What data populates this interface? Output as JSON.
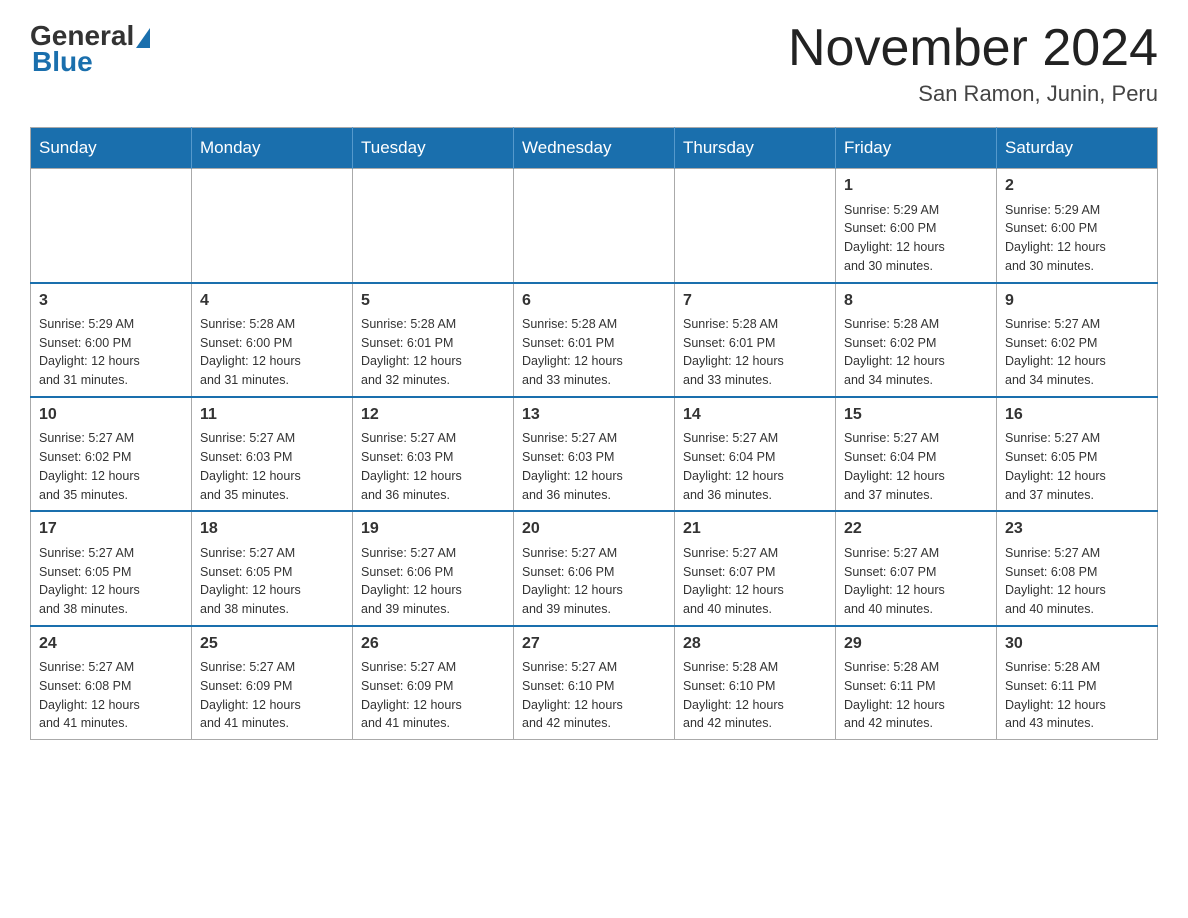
{
  "header": {
    "logo": {
      "general": "General",
      "blue": "Blue"
    },
    "title": "November 2024",
    "location": "San Ramon, Junin, Peru"
  },
  "weekdays": [
    "Sunday",
    "Monday",
    "Tuesday",
    "Wednesday",
    "Thursday",
    "Friday",
    "Saturday"
  ],
  "weeks": [
    [
      {
        "day": "",
        "info": ""
      },
      {
        "day": "",
        "info": ""
      },
      {
        "day": "",
        "info": ""
      },
      {
        "day": "",
        "info": ""
      },
      {
        "day": "",
        "info": ""
      },
      {
        "day": "1",
        "info": "Sunrise: 5:29 AM\nSunset: 6:00 PM\nDaylight: 12 hours\nand 30 minutes."
      },
      {
        "day": "2",
        "info": "Sunrise: 5:29 AM\nSunset: 6:00 PM\nDaylight: 12 hours\nand 30 minutes."
      }
    ],
    [
      {
        "day": "3",
        "info": "Sunrise: 5:29 AM\nSunset: 6:00 PM\nDaylight: 12 hours\nand 31 minutes."
      },
      {
        "day": "4",
        "info": "Sunrise: 5:28 AM\nSunset: 6:00 PM\nDaylight: 12 hours\nand 31 minutes."
      },
      {
        "day": "5",
        "info": "Sunrise: 5:28 AM\nSunset: 6:01 PM\nDaylight: 12 hours\nand 32 minutes."
      },
      {
        "day": "6",
        "info": "Sunrise: 5:28 AM\nSunset: 6:01 PM\nDaylight: 12 hours\nand 33 minutes."
      },
      {
        "day": "7",
        "info": "Sunrise: 5:28 AM\nSunset: 6:01 PM\nDaylight: 12 hours\nand 33 minutes."
      },
      {
        "day": "8",
        "info": "Sunrise: 5:28 AM\nSunset: 6:02 PM\nDaylight: 12 hours\nand 34 minutes."
      },
      {
        "day": "9",
        "info": "Sunrise: 5:27 AM\nSunset: 6:02 PM\nDaylight: 12 hours\nand 34 minutes."
      }
    ],
    [
      {
        "day": "10",
        "info": "Sunrise: 5:27 AM\nSunset: 6:02 PM\nDaylight: 12 hours\nand 35 minutes."
      },
      {
        "day": "11",
        "info": "Sunrise: 5:27 AM\nSunset: 6:03 PM\nDaylight: 12 hours\nand 35 minutes."
      },
      {
        "day": "12",
        "info": "Sunrise: 5:27 AM\nSunset: 6:03 PM\nDaylight: 12 hours\nand 36 minutes."
      },
      {
        "day": "13",
        "info": "Sunrise: 5:27 AM\nSunset: 6:03 PM\nDaylight: 12 hours\nand 36 minutes."
      },
      {
        "day": "14",
        "info": "Sunrise: 5:27 AM\nSunset: 6:04 PM\nDaylight: 12 hours\nand 36 minutes."
      },
      {
        "day": "15",
        "info": "Sunrise: 5:27 AM\nSunset: 6:04 PM\nDaylight: 12 hours\nand 37 minutes."
      },
      {
        "day": "16",
        "info": "Sunrise: 5:27 AM\nSunset: 6:05 PM\nDaylight: 12 hours\nand 37 minutes."
      }
    ],
    [
      {
        "day": "17",
        "info": "Sunrise: 5:27 AM\nSunset: 6:05 PM\nDaylight: 12 hours\nand 38 minutes."
      },
      {
        "day": "18",
        "info": "Sunrise: 5:27 AM\nSunset: 6:05 PM\nDaylight: 12 hours\nand 38 minutes."
      },
      {
        "day": "19",
        "info": "Sunrise: 5:27 AM\nSunset: 6:06 PM\nDaylight: 12 hours\nand 39 minutes."
      },
      {
        "day": "20",
        "info": "Sunrise: 5:27 AM\nSunset: 6:06 PM\nDaylight: 12 hours\nand 39 minutes."
      },
      {
        "day": "21",
        "info": "Sunrise: 5:27 AM\nSunset: 6:07 PM\nDaylight: 12 hours\nand 40 minutes."
      },
      {
        "day": "22",
        "info": "Sunrise: 5:27 AM\nSunset: 6:07 PM\nDaylight: 12 hours\nand 40 minutes."
      },
      {
        "day": "23",
        "info": "Sunrise: 5:27 AM\nSunset: 6:08 PM\nDaylight: 12 hours\nand 40 minutes."
      }
    ],
    [
      {
        "day": "24",
        "info": "Sunrise: 5:27 AM\nSunset: 6:08 PM\nDaylight: 12 hours\nand 41 minutes."
      },
      {
        "day": "25",
        "info": "Sunrise: 5:27 AM\nSunset: 6:09 PM\nDaylight: 12 hours\nand 41 minutes."
      },
      {
        "day": "26",
        "info": "Sunrise: 5:27 AM\nSunset: 6:09 PM\nDaylight: 12 hours\nand 41 minutes."
      },
      {
        "day": "27",
        "info": "Sunrise: 5:27 AM\nSunset: 6:10 PM\nDaylight: 12 hours\nand 42 minutes."
      },
      {
        "day": "28",
        "info": "Sunrise: 5:28 AM\nSunset: 6:10 PM\nDaylight: 12 hours\nand 42 minutes."
      },
      {
        "day": "29",
        "info": "Sunrise: 5:28 AM\nSunset: 6:11 PM\nDaylight: 12 hours\nand 42 minutes."
      },
      {
        "day": "30",
        "info": "Sunrise: 5:28 AM\nSunset: 6:11 PM\nDaylight: 12 hours\nand 43 minutes."
      }
    ]
  ]
}
